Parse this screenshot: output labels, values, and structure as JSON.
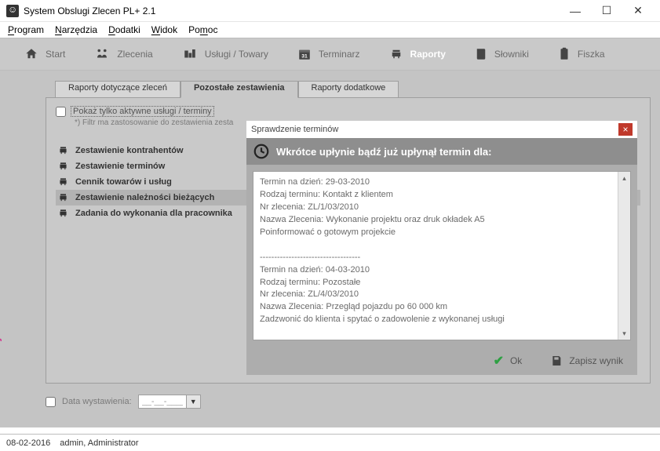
{
  "window": {
    "title": "System Obslugi Zlecen PL+ 2.1"
  },
  "menu": {
    "program": "Program",
    "narzedzia": "Narzędzia",
    "dodatki": "Dodatki",
    "widok": "Widok",
    "pomoc": "Pomoc"
  },
  "toolbar": {
    "start": "Start",
    "zlecenia": "Zlecenia",
    "uslugi": "Usługi / Towary",
    "terminarz": "Terminarz",
    "raporty": "Raporty",
    "slowniki": "Słowniki",
    "fiszka": "Fiszka"
  },
  "tabs": {
    "t1": "Raporty dotyczące zleceń",
    "t2": "Pozostałe zestawienia",
    "t3": "Raporty dodatkowe"
  },
  "filter": {
    "label": "Pokaż tylko aktywne usługi / terminy",
    "help": "*) Filtr ma zastosowanie do zestawienia zesta"
  },
  "reports": {
    "r0": "Zestawienie kontrahentów",
    "r1": "Zestawienie terminów",
    "r2": "Cennik towarów i usług",
    "r3": "Zestawienie należności bieżących",
    "r4": "Zadania do wykonania dla pracownika"
  },
  "date": {
    "label": "Data wystawienia:",
    "value": "__-__-____"
  },
  "dialog": {
    "title": "Sprawdzenie terminów",
    "banner": "Wkrótce upłynie bądź już upłynął termin dla:",
    "body": "Termin na dzień: 29-03-2010\nRodzaj terminu: Kontakt z klientem\nNr zlecenia: ZL/1/03/2010\nNazwa Zlecenia: Wykonanie projektu oraz druk okładek A5\nPoinformować o gotowym projekcie\n\n-----------------------------------\nTermin na dzień: 04-03-2010\nRodzaj terminu: Pozostałe\nNr zlecenia: ZL/4/03/2010\nNazwa Zlecenia: Przegląd pojazdu po 60 000 km\nZadzwonić do klienta i spytać o zadowolenie z wykonanej usługi",
    "ok": "Ok",
    "save": "Zapisz wynik"
  },
  "status": {
    "date": "08-02-2016",
    "user": "admin, Administrator"
  }
}
